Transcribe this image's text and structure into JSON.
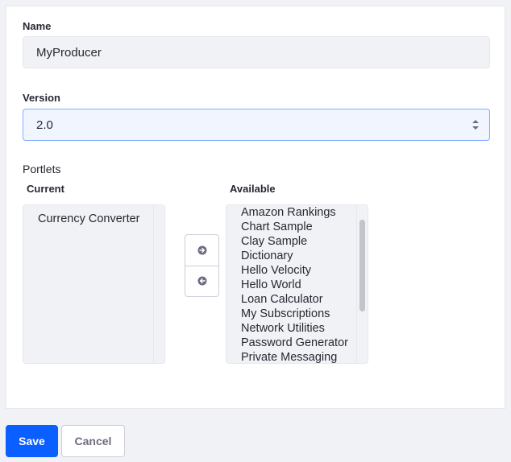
{
  "form": {
    "name_label": "Name",
    "name_value": "MyProducer",
    "version_label": "Version",
    "version_value": "2.0",
    "portlets_label": "Portlets",
    "current_label": "Current",
    "available_label": "Available"
  },
  "current_items": [
    "Currency Converter"
  ],
  "available_items": [
    "Amazon Rankings",
    "Chart Sample",
    "Clay Sample",
    "Dictionary",
    "Hello Velocity",
    "Hello World",
    "Loan Calculator",
    "My Subscriptions",
    "Network Utilities",
    "Password Generator",
    "Private Messaging"
  ],
  "buttons": {
    "save_label": "Save",
    "cancel_label": "Cancel"
  },
  "icons": {
    "move_right": "arrow-right-icon",
    "move_left": "arrow-left-icon",
    "select": "caret-double-icon"
  },
  "colors": {
    "primary": "#0b5fff",
    "select_focus_border": "#80acff",
    "select_focus_bg": "#f0f5ff"
  }
}
